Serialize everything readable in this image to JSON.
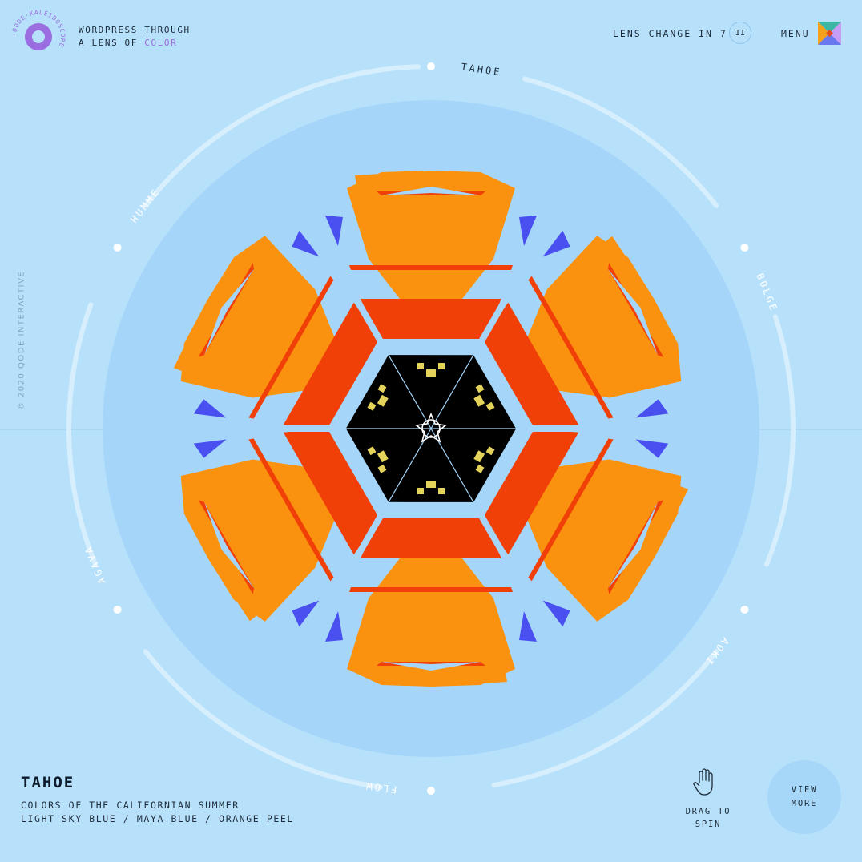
{
  "brand": {
    "logo_text": "·QODE·KALEIDOSCOPE",
    "tagline_line1": "WORDPRESS THROUGH",
    "tagline_line2_prefix": "A LENS OF",
    "tagline_accent": "COLOR"
  },
  "header": {
    "lens_change_text": "LENS CHANGE IN 7",
    "pause_glyph": "II",
    "menu_label": "MENU"
  },
  "side_text": "© 2020 QODE INTERACTIVE",
  "lenses": [
    "TAHOE",
    "BOLGE",
    "AOKI",
    "FLOW",
    "AGAVA",
    "HUMME"
  ],
  "current": {
    "title": "TAHOE",
    "subtitle": "COLORS OF THE CALIFORNIAN SUMMER",
    "palette": "LIGHT SKY BLUE / MAYA BLUE / ORANGE PEEL"
  },
  "drag_hint": {
    "line1": "DRAG TO",
    "line2": "SPIN"
  },
  "view_more": {
    "line1": "VIEW",
    "line2": "MORE"
  },
  "icons": {
    "logo": "qode-ring-logo-icon",
    "pause": "pause-icon",
    "menu": "kaleidoscope-menu-icon",
    "hand": "hand-icon"
  },
  "colors": {
    "background": "#b7e1fb",
    "inner_circle": "#a5d6fa",
    "orange": "#fa920f",
    "red_orange": "#f04008",
    "blue": "#4a50ef",
    "black": "#000000",
    "yellow": "#e3d35a",
    "accent_purple": "#9a6ee0"
  }
}
